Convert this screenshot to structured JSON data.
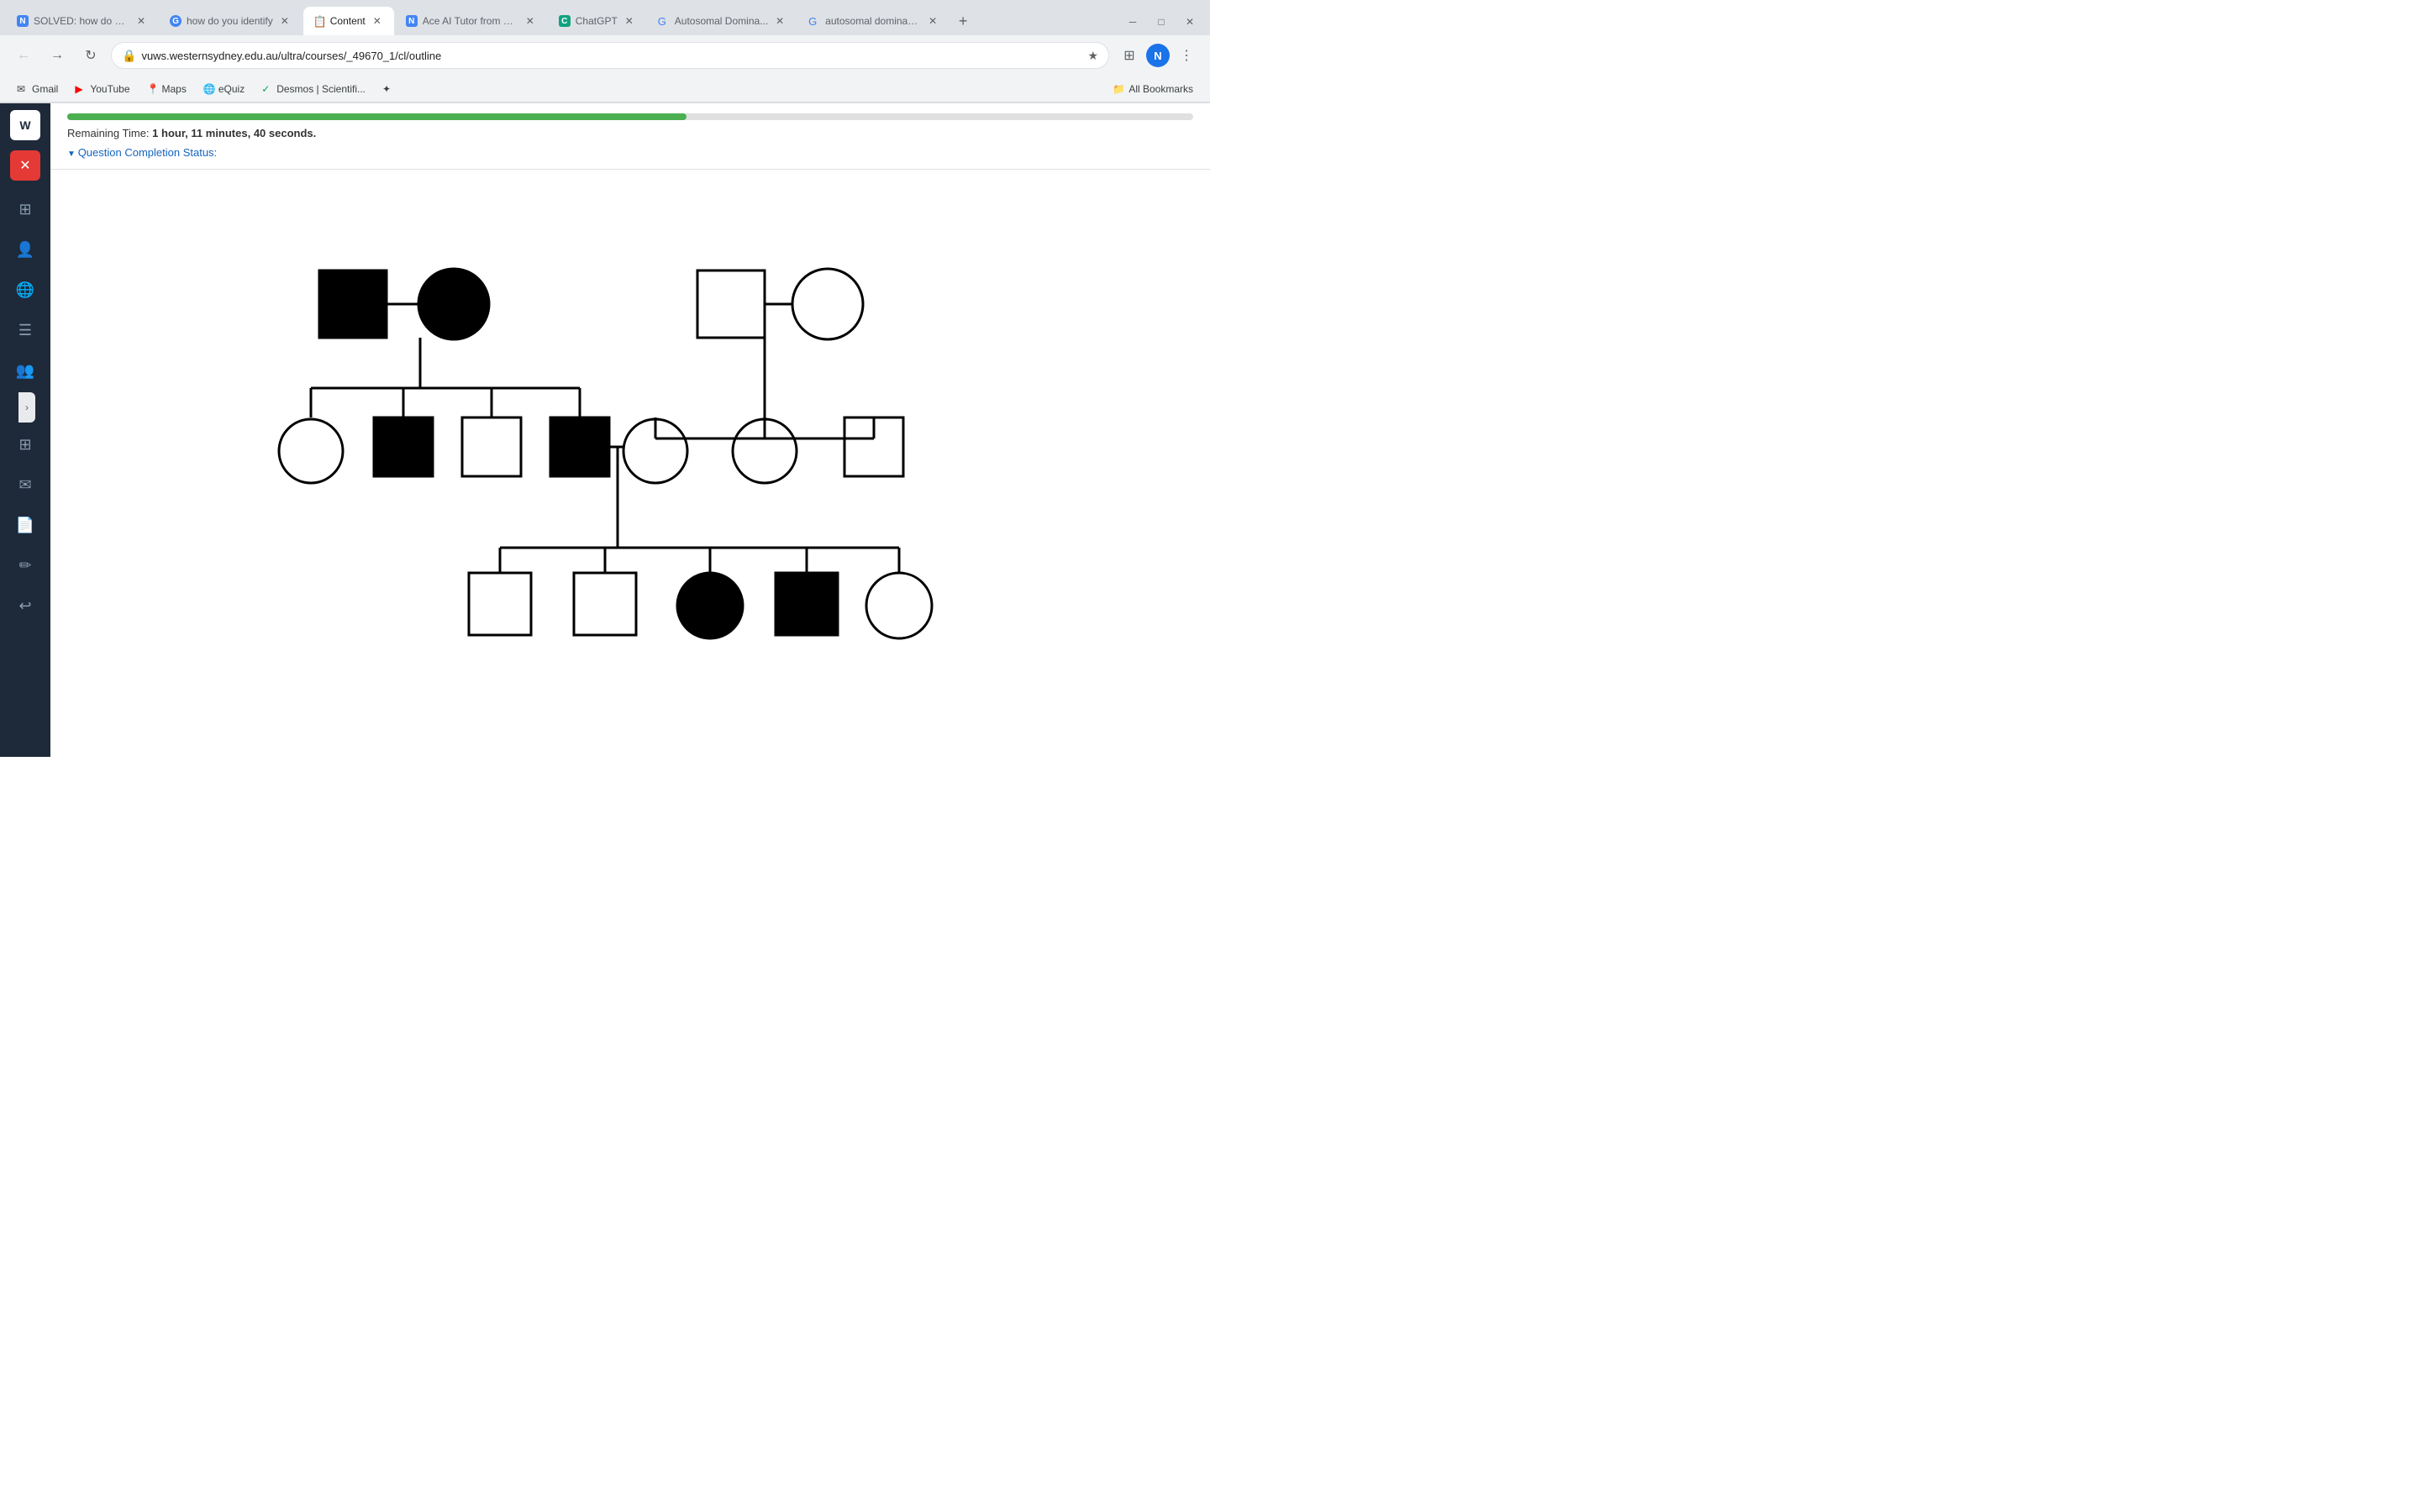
{
  "browser": {
    "tabs": [
      {
        "id": "tab1",
        "title": "SOLVED: how do yo...",
        "favicon": "N",
        "favicon_color": "#4285f4",
        "active": false
      },
      {
        "id": "tab2",
        "title": "how do you identify",
        "favicon": "G",
        "favicon_color": "#4285f4",
        "active": false
      },
      {
        "id": "tab3",
        "title": "Content",
        "favicon": "📋",
        "favicon_color": "#e53935",
        "active": true
      },
      {
        "id": "tab4",
        "title": "Ace AI Tutor from N...",
        "favicon": "N",
        "favicon_color": "#4285f4",
        "active": false
      },
      {
        "id": "tab5",
        "title": "ChatGPT",
        "favicon": "C",
        "favicon_color": "#10a37f",
        "active": false
      },
      {
        "id": "tab6",
        "title": "Autosomal Domina...",
        "favicon": "G",
        "favicon_color": "#4285f4",
        "active": false
      },
      {
        "id": "tab7",
        "title": "autosomal dominan...",
        "favicon": "G",
        "favicon_color": "#4285f4",
        "active": false
      }
    ],
    "url": "vuws.westernsydney.edu.au/ultra/courses/_49670_1/cl/outline",
    "bookmarks": [
      {
        "label": "Gmail",
        "favicon": "✉"
      },
      {
        "label": "YouTube",
        "favicon": "▶"
      },
      {
        "label": "Maps",
        "favicon": "📍"
      },
      {
        "label": "eQuiz",
        "favicon": "🌐"
      },
      {
        "label": "Desmos | Scientifi...",
        "favicon": "✓"
      },
      {
        "label": "✦",
        "favicon": ""
      }
    ],
    "all_bookmarks_label": "All Bookmarks"
  },
  "quiz": {
    "remaining_time_label": "Remaining Time:",
    "remaining_time_value": "1 hour, 11 minutes, 40 seconds.",
    "question_status_label": "Question Completion Status:"
  },
  "sidebar": {
    "items": [
      {
        "name": "dashboard",
        "icon": "⊞"
      },
      {
        "name": "profile",
        "icon": "👤"
      },
      {
        "name": "globe",
        "icon": "🌐"
      },
      {
        "name": "list",
        "icon": "☰"
      },
      {
        "name": "group",
        "icon": "👥"
      },
      {
        "name": "calendar",
        "icon": "📅"
      },
      {
        "name": "mail",
        "icon": "✉"
      },
      {
        "name": "document",
        "icon": "📄"
      },
      {
        "name": "edit",
        "icon": "✏"
      },
      {
        "name": "back",
        "icon": "↩"
      }
    ]
  }
}
